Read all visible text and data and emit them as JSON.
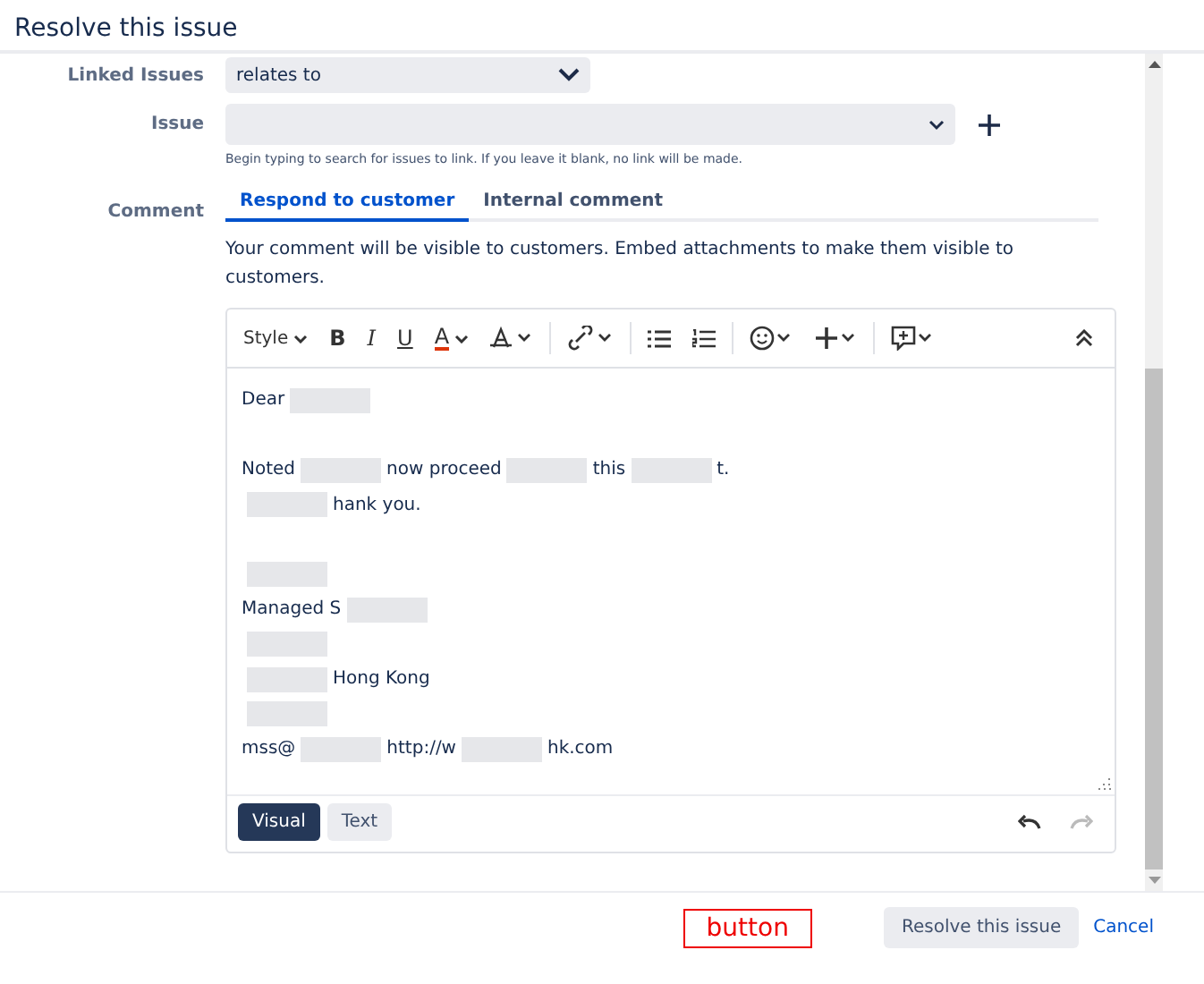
{
  "dialog": {
    "title": "Resolve this issue"
  },
  "linked_issues": {
    "label": "Linked Issues",
    "value": "relates to"
  },
  "issue": {
    "label": "Issue",
    "help": "Begin typing to search for issues to link. If you leave it blank, no link will be made."
  },
  "comment": {
    "label": "Comment",
    "tabs": [
      {
        "label": "Respond to customer",
        "selected": true
      },
      {
        "label": "Internal comment",
        "selected": false
      }
    ],
    "notice": "Your comment will be visible to customers. Embed attachments to make them visible to customers.",
    "toolbar": [
      {
        "kind": "style",
        "label": "Style"
      },
      {
        "kind": "bold",
        "label": "B"
      },
      {
        "kind": "italic",
        "label": "I"
      },
      {
        "kind": "underline",
        "label": "U"
      },
      {
        "kind": "color",
        "label": "A"
      },
      {
        "kind": "format"
      },
      {
        "kind": "sep"
      },
      {
        "kind": "link"
      },
      {
        "kind": "sep"
      },
      {
        "kind": "bullets"
      },
      {
        "kind": "numbers"
      },
      {
        "kind": "sep"
      },
      {
        "kind": "emoji"
      },
      {
        "kind": "plus"
      },
      {
        "kind": "sep"
      },
      {
        "kind": "comment"
      }
    ],
    "lines": [
      {
        "kind": "text",
        "segments": [
          {
            "kind": "text",
            "text": "Dear"
          },
          {
            "kind": "redaction"
          }
        ]
      },
      {
        "kind": "blank"
      },
      {
        "kind": "text",
        "segments": [
          {
            "kind": "text",
            "text": "Noted"
          },
          {
            "kind": "redaction"
          },
          {
            "kind": "text",
            "text": "now proceed"
          },
          {
            "kind": "redaction"
          },
          {
            "kind": "text",
            "text": "this"
          },
          {
            "kind": "redaction"
          },
          {
            "kind": "text",
            "text": "t."
          }
        ]
      },
      {
        "kind": "text",
        "segments": [
          {
            "kind": "redaction"
          },
          {
            "kind": "text",
            "text": "hank you."
          }
        ]
      },
      {
        "kind": "blank"
      },
      {
        "kind": "text",
        "segments": [
          {
            "kind": "redaction"
          }
        ]
      },
      {
        "kind": "text",
        "segments": [
          {
            "kind": "text",
            "text": "Managed S"
          },
          {
            "kind": "redaction"
          }
        ]
      },
      {
        "kind": "text",
        "segments": [
          {
            "kind": "redaction"
          }
        ]
      },
      {
        "kind": "text",
        "segments": [
          {
            "kind": "redaction"
          },
          {
            "kind": "text",
            "text": "Hong Kong"
          }
        ]
      },
      {
        "kind": "text",
        "segments": [
          {
            "kind": "redaction"
          }
        ]
      },
      {
        "kind": "text",
        "segments": [
          {
            "kind": "text",
            "text": "mss@"
          },
          {
            "kind": "redaction"
          },
          {
            "kind": "text",
            "text": "http://w"
          },
          {
            "kind": "redaction"
          },
          {
            "kind": "text",
            "text": "hk.com"
          }
        ]
      }
    ],
    "modes": [
      {
        "label": "Visual",
        "selected": true
      },
      {
        "label": "Text",
        "selected": false
      }
    ]
  },
  "annotation": "button",
  "buttons": {
    "primary": "Resolve this issue",
    "cancel": "Cancel"
  }
}
